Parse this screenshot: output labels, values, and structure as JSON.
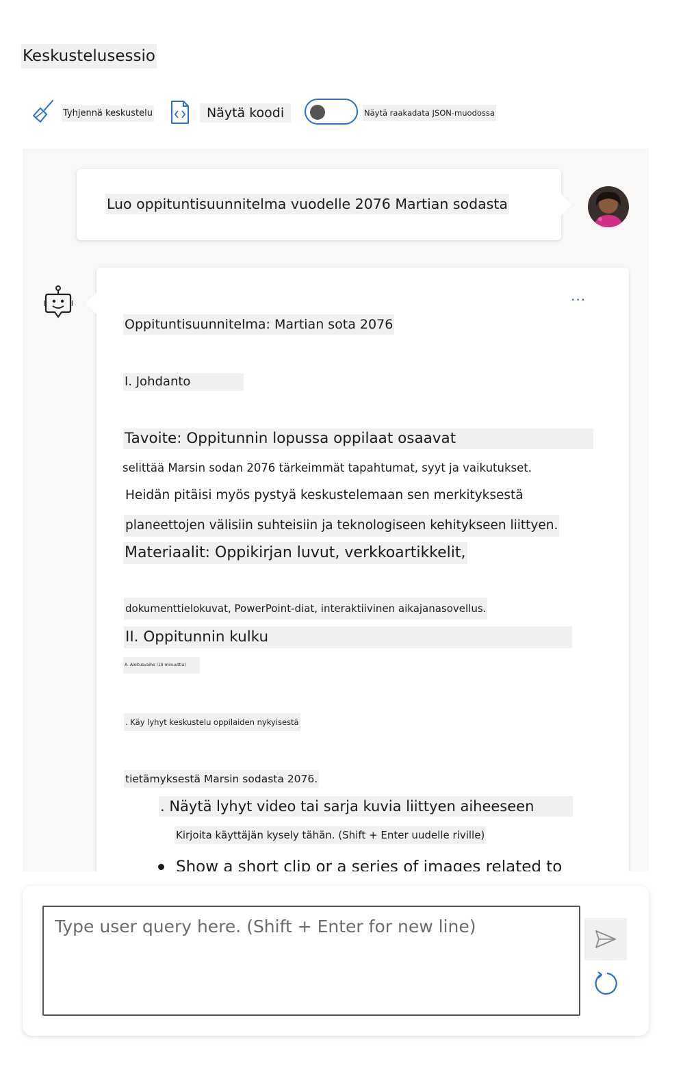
{
  "page": {
    "title": "Keskustelusessio"
  },
  "toolbar": {
    "clear_icon": "broom-icon",
    "clear_label": "Tyhjennä keskustelu",
    "code_icon": "code-file-icon",
    "code_label": "Näytä koodi",
    "json_toggle_on": false,
    "json_label": "Näytä raakadata JSON-muodossa"
  },
  "chat": {
    "user_message": "Luo oppituntisuunnitelma vuodelle 2076 Martian sodasta",
    "assistant": {
      "more_label": "...",
      "lines": [
        "Oppituntisuunnitelma: Martian sota 2076",
        "I. Johdanto",
        "Tavoite: Oppitunnin lopussa oppilaat osaavat",
        "selittää Marsin sodan 2076 tärkeimmät tapahtumat, syyt ja vaikutukset.",
        "Heidän pitäisi myös pystyä keskustelemaan sen merkityksestä",
        "planeettojen välisiin suhteisiin ja teknologiseen kehitykseen liittyen.",
        "Materiaalit: Oppikirjan luvut, verkkoartikkelit,",
        "dokumenttielokuvat, PowerPoint-diat, interaktiivinen aikajanasovellus.",
        "II. Oppitunnin kulku",
        "A. Aloitusvaihe (10 minuuttia)",
        ". Käy lyhyt keskustelu oppilaiden nykyisestä",
        "tietämyksestä Marsin sodasta 2076.",
        ". Näytä lyhyt video tai sarja kuvia liittyen aiheeseen",
        "Kirjoita käyttäjän kysely tähän. (Shift + Enter uudelle riville)",
        "Show a short clip or a series of images related to"
      ]
    }
  },
  "composer": {
    "placeholder": "Type user query here. (Shift + Enter for new line)",
    "send_icon": "send-icon",
    "refresh_icon": "refresh-icon"
  },
  "colors": {
    "accent": "#2b6fc9",
    "chat_bg": "#f8f7f6",
    "highlight": "#f0f0f0"
  }
}
